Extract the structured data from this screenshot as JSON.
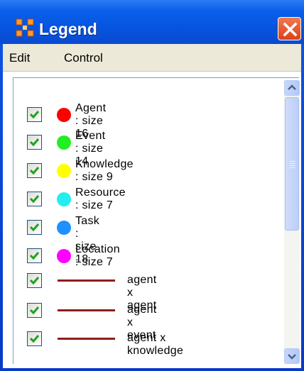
{
  "window": {
    "title": "Legend"
  },
  "menu": [
    "Edit",
    "Control"
  ],
  "legend": {
    "nodes": [
      {
        "label": "Agent : size 16",
        "color": "#ff0000",
        "checked": true
      },
      {
        "label": "Event : size 14",
        "color": "#22ee22",
        "checked": true
      },
      {
        "label": "Knowledge : size 9",
        "color": "#ffff00",
        "checked": true
      },
      {
        "label": "Resource : size 7",
        "color": "#22eeee",
        "checked": true
      },
      {
        "label": "Task : size 18",
        "color": "#1e90ff",
        "checked": true
      },
      {
        "label": "Location : size 7",
        "color": "#ff00ff",
        "checked": true
      }
    ],
    "links": [
      {
        "label": "agent x agent",
        "color": "#8b1e1e",
        "checked": true
      },
      {
        "label": "agent x event",
        "color": "#8b1e1e",
        "checked": true
      },
      {
        "label": "agent x knowledge",
        "color": "#8b1e1e",
        "checked": true
      }
    ]
  },
  "icons": {
    "app": "four-dots-icon",
    "close": "close-icon",
    "scroll_up": "scroll-up-arrow-icon",
    "scroll_down": "scroll-down-arrow-icon",
    "check": "checkmark-icon"
  }
}
